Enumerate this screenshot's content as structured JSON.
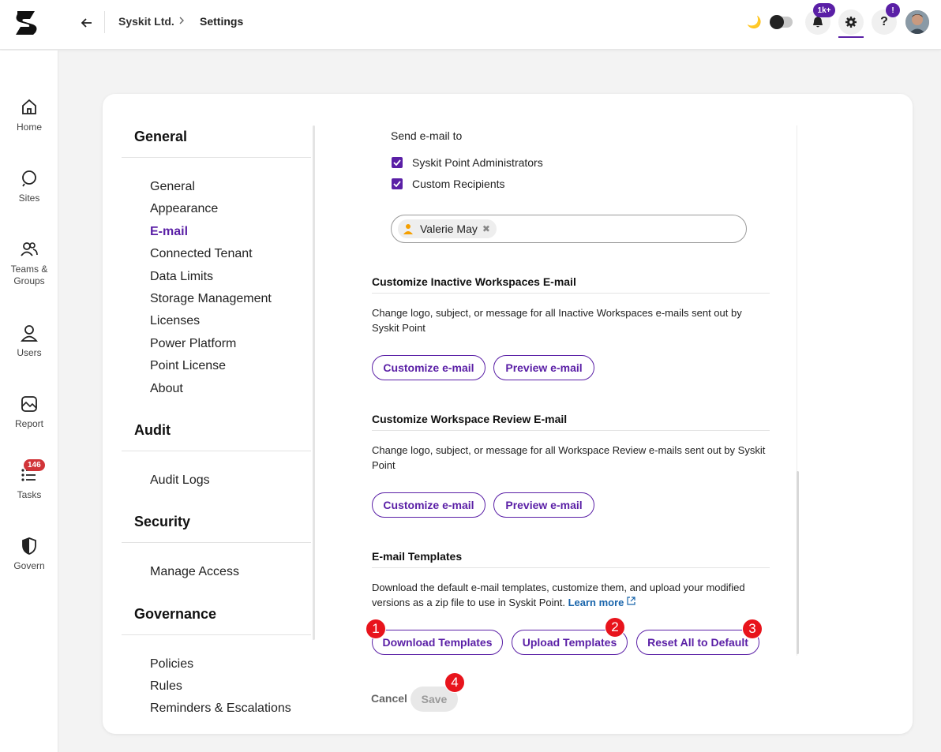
{
  "header": {
    "breadcrumb": [
      "Syskit Ltd.",
      "Settings"
    ],
    "breadcrumb_separator": ">",
    "notifications_count": "1k+",
    "help_badge": "!",
    "help_label": "?",
    "moon_glyph": "🌙"
  },
  "leftnav": {
    "items": [
      {
        "label": "Home",
        "icon": "home-icon"
      },
      {
        "label": "Sites",
        "icon": "sites-icon"
      },
      {
        "label": "Teams & Groups",
        "icon": "teams-groups-icon"
      },
      {
        "label": "Users",
        "icon": "user-icon"
      },
      {
        "label": "Report",
        "icon": "report-icon"
      },
      {
        "label": "Tasks",
        "icon": "tasks-icon",
        "badge": "146"
      },
      {
        "label": "Govern",
        "icon": "shield-icon"
      }
    ]
  },
  "settings_nav": {
    "sections": [
      {
        "title": "General",
        "items": [
          "General",
          "Appearance",
          "E-mail",
          "Connected Tenant",
          "Data Limits",
          "Storage Management",
          "Licenses",
          "Power Platform",
          "Point License",
          "About"
        ],
        "active": "E-mail"
      },
      {
        "title": "Audit",
        "items": [
          "Audit Logs"
        ]
      },
      {
        "title": "Security",
        "items": [
          "Manage Access"
        ]
      },
      {
        "title": "Governance",
        "items": [
          "Policies",
          "Rules",
          "Reminders & Escalations"
        ]
      }
    ]
  },
  "email": {
    "send_to_label": "Send e-mail to",
    "recipients_options": [
      {
        "label": "Syskit Point Administrators",
        "checked": true
      },
      {
        "label": "Custom Recipients",
        "checked": true
      }
    ],
    "recipient_chip": "Valerie May",
    "inactive": {
      "title": "Customize Inactive Workspaces E-mail",
      "description": "Change logo, subject, or message for all Inactive Workspaces e-mails sent out by Syskit Point",
      "customize_label": "Customize e-mail",
      "preview_label": "Preview e-mail"
    },
    "review": {
      "title": "Customize Workspace Review E-mail",
      "description": "Change logo, subject, or message for all Workspace Review e-mails sent out by Syskit Point",
      "customize_label": "Customize e-mail",
      "preview_label": "Preview e-mail"
    },
    "templates": {
      "title": "E-mail Templates",
      "description": "Download the default e-mail templates, customize them, and upload your modified versions as a zip file to use in Syskit Point.",
      "learn_more": "Learn more",
      "download_label": "Download Templates",
      "upload_label": "Upload Templates",
      "reset_label": "Reset All to Default"
    },
    "cancel_label": "Cancel",
    "save_label": "Save"
  },
  "annotations": [
    "1",
    "2",
    "3",
    "4"
  ],
  "colors": {
    "accent": "#5a1fa6",
    "annotation": "#e8141c",
    "task_badge": "#d13438"
  }
}
